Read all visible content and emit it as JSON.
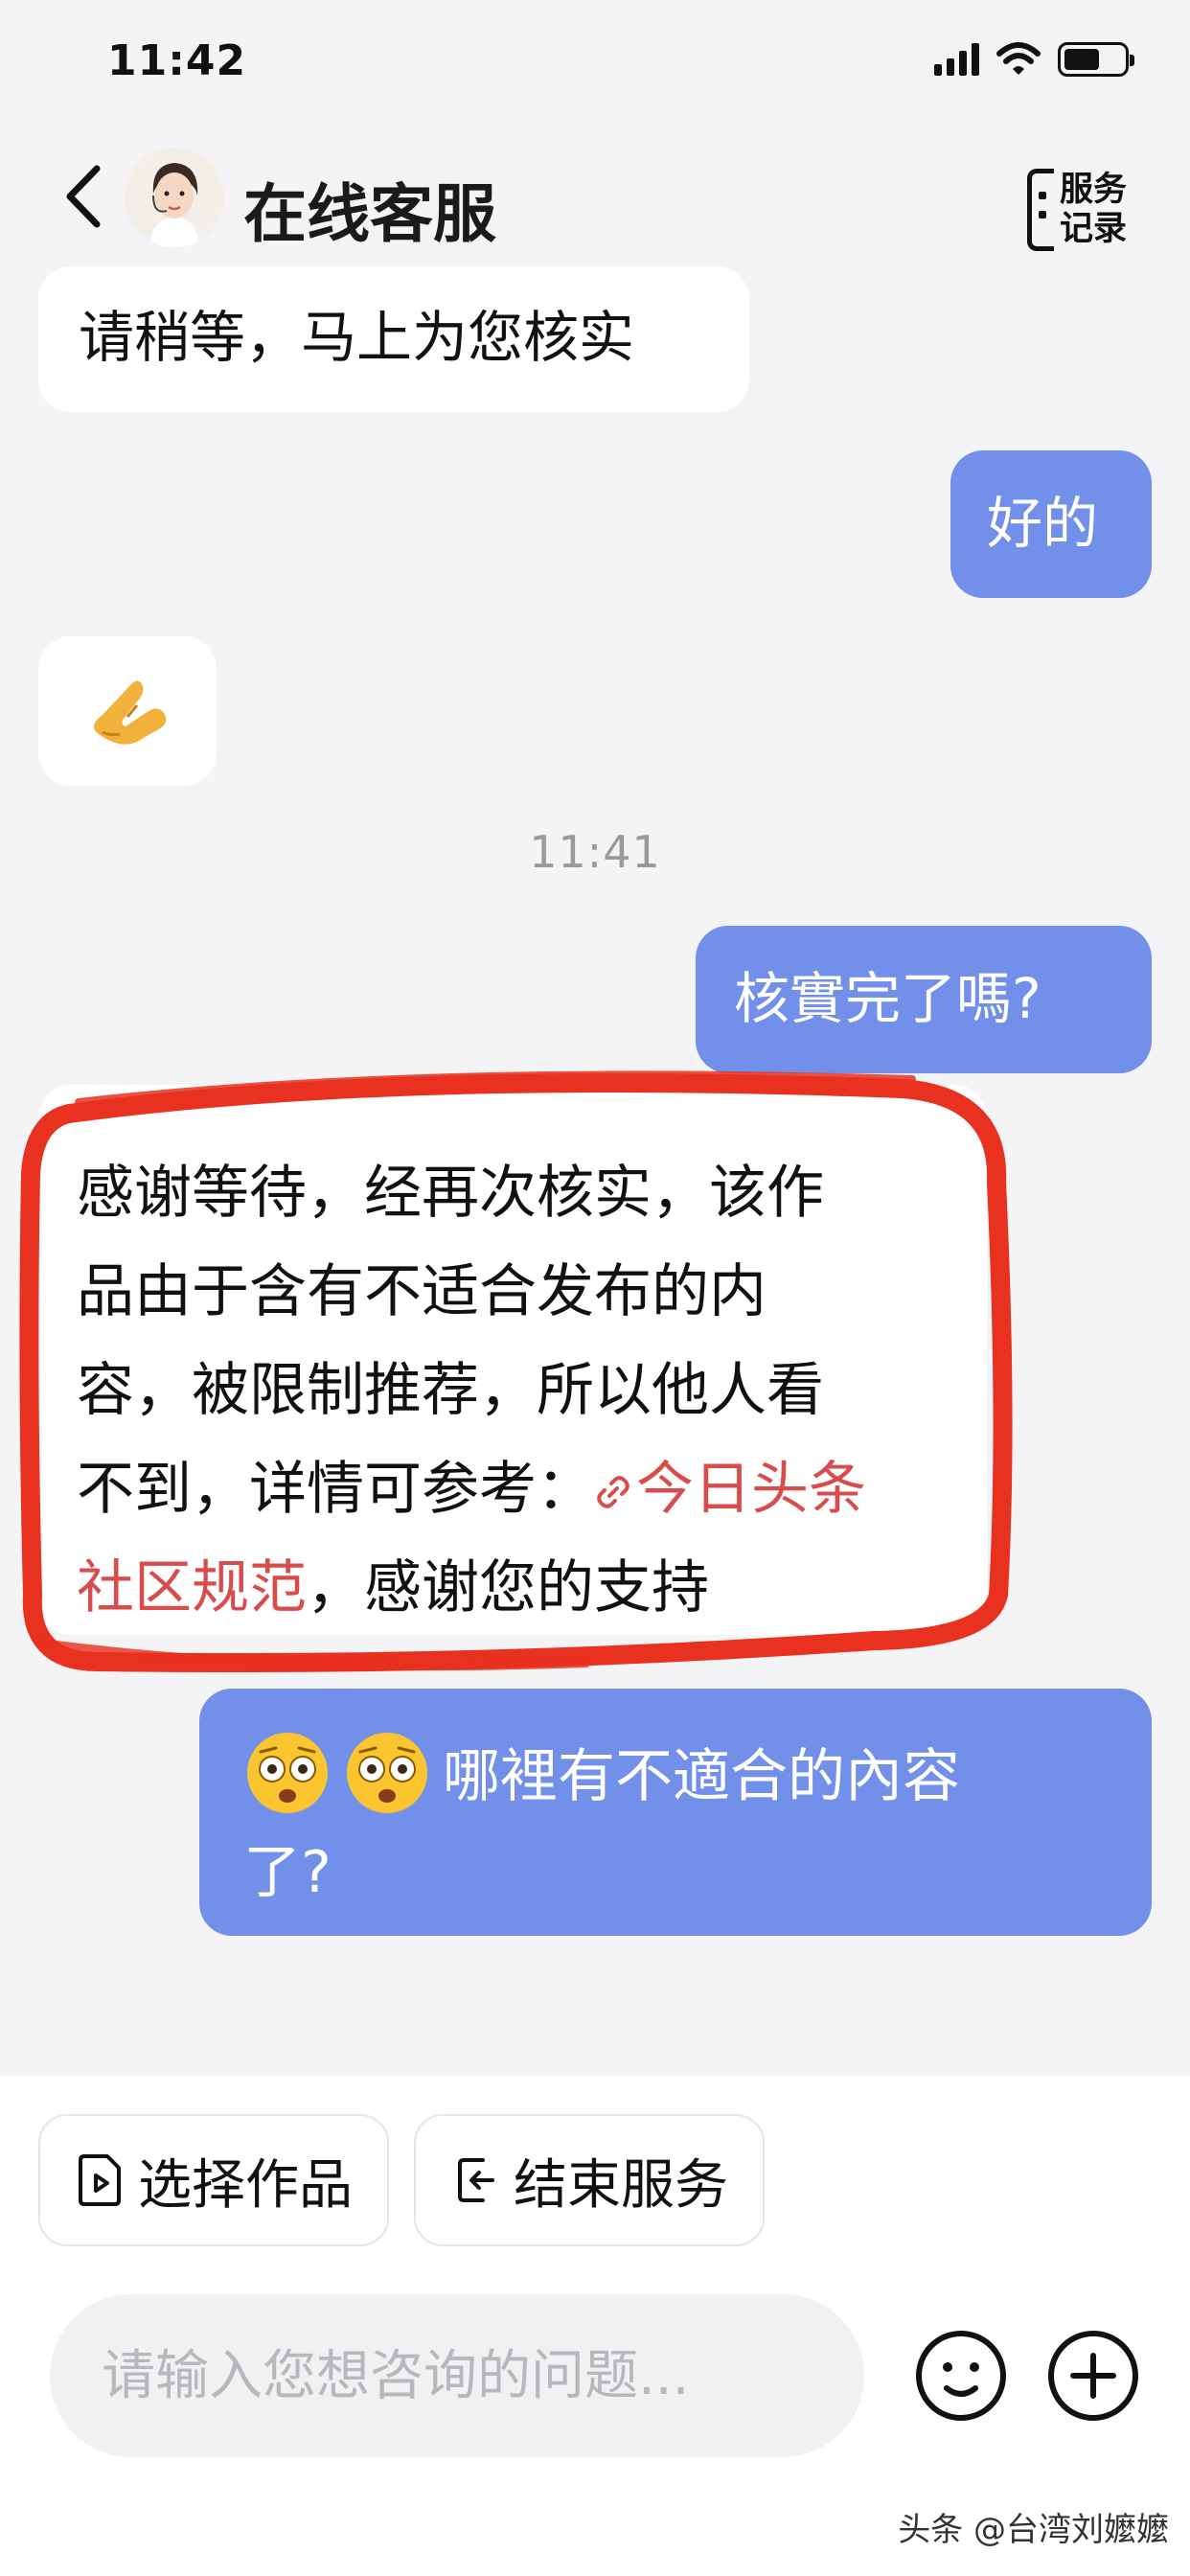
{
  "status_bar": {
    "time": "11:42"
  },
  "header": {
    "title": "在线客服",
    "records_label": "服务记录",
    "records_line1": "服务",
    "records_line2": "记录"
  },
  "messages": [
    {
      "side": "left",
      "text": "请稍等，马上为您核实"
    },
    {
      "side": "right",
      "text": "好的"
    },
    {
      "side": "left",
      "emoji": "folded-hands-emoji"
    },
    {
      "timestamp": "11:41"
    },
    {
      "side": "right",
      "text": "核實完了嗎?"
    },
    {
      "side": "left",
      "text_before_link": "感谢等待，经再次核实，该作品由于含有不适合发布的内容，被限制推荐，所以他人看不到，详情可参考：",
      "link_text": "今日头条社区规范",
      "text_after_link": "，感谢您的支持",
      "line1": "感谢等待，经再次核实，该作",
      "line2": "品由于含有不适合发布的内",
      "line3": "容，被限制推荐，所以他人看",
      "line4_text": "不到，详情可参考：",
      "line4_link": "今日头条",
      "line5_link": "社区规范",
      "line5_text": "，感谢您的支持"
    },
    {
      "side": "right",
      "emojis": [
        "flushed-face-emoji",
        "flushed-face-emoji"
      ],
      "text": "哪裡有不適合的內容了?",
      "line1": "哪裡有不適合的內容",
      "line2": "了?"
    }
  ],
  "actions": [
    {
      "label": "选择作品",
      "icon": "document-play-icon"
    },
    {
      "label": "结束服务",
      "icon": "exit-icon"
    }
  ],
  "input": {
    "placeholder": "请输入您想咨询的问题..."
  },
  "watermark": "头条 @台湾刘嬤嬤",
  "colors": {
    "background": "#f4f4f6",
    "user_bubble": "#7290ea",
    "agent_bubble": "#ffffff",
    "link": "#d84c4c",
    "annotation": "#e8311f"
  }
}
